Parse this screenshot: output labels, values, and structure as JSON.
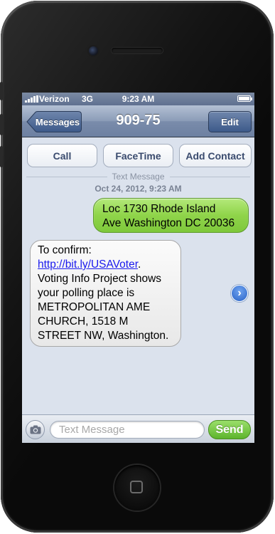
{
  "status_bar": {
    "carrier": "Verizon",
    "network": "3G",
    "time": "9:23 AM"
  },
  "nav": {
    "back_label": "Messages",
    "title": "909-75",
    "edit_label": "Edit"
  },
  "actions": {
    "call_label": "Call",
    "facetime_label": "FaceTime",
    "add_contact_label": "Add Contact"
  },
  "thread": {
    "type_label": "Text Message",
    "timestamp": "Oct 24, 2012, 9:23 AM"
  },
  "messages": [
    {
      "direction": "outgoing",
      "lines": [
        "Loc 1730 Rhode Island",
        "Ave Washington DC 20036"
      ]
    },
    {
      "direction": "incoming",
      "lead": "To confirm:",
      "link": "http://bit.ly/USAVoter",
      "link_suffix": ".",
      "lines": [
        "Voting Info Project shows",
        "your polling place is",
        "METROPOLITAN AME",
        "CHURCH, 1518 M",
        "STREET NW, Washington."
      ]
    }
  ],
  "composer": {
    "placeholder": "Text Message",
    "send_label": "Send"
  },
  "colors": {
    "outgoing_bubble": "#8fd44a",
    "incoming_bubble": "#eeeeee",
    "link": "#1a1aee",
    "nav_bar": "#7a8cab"
  },
  "icons": {
    "back": "chevron-left-icon",
    "disclosure": "chevron-right-circle-icon",
    "camera": "camera-icon"
  }
}
